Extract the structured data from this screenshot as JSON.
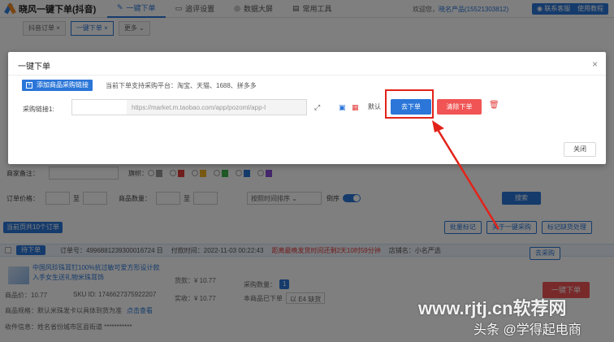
{
  "app": {
    "title": "晓风一键下单(抖音)",
    "nav_tabs": [
      {
        "label": "一键下单",
        "icon": "✎"
      },
      {
        "label": "追评设置",
        "icon": "▭"
      },
      {
        "label": "数据大屏",
        "icon": "◎"
      },
      {
        "label": "常用工具",
        "icon": "▤"
      }
    ],
    "welcome_prefix": "欢迎您，",
    "welcome_user": "晓名产品(15521303812)",
    "contact_label": "联系客服",
    "help_label": "使用教程"
  },
  "page_tabs": [
    {
      "label": "抖音订单 ×"
    },
    {
      "label": "一键下单 ×"
    },
    {
      "label": "更多 ⌄"
    }
  ],
  "background": {
    "remark_label": "商家备注：",
    "flag_label": "旗帜：",
    "price_label": "订单价格：",
    "price_to": "至",
    "qty_label": "商品数量：",
    "sort_placeholder": "按照时间排序",
    "reverse_label": "倒序",
    "search_label": "搜索",
    "current_page_label": "当前页共10个订单",
    "batch_remark": "批量标记",
    "batch_purchase": "关于一键采购",
    "batch_stockout": "标记缺货处理",
    "order_btn": "待下单",
    "order_no": "订单号：4996881239300016724 日",
    "pay_time": "付款时间：2022-11-03 00:22:43",
    "warning": "距离最晚发货时间还剩2天10时59分钟",
    "shop_label": "店铺名：",
    "shop_name": "小名严选",
    "product_title": "中国风珍珠耳钉100%抗过敏可爱方形设计款",
    "product_sub": "入手女生送礼物米珠耳饰",
    "price_info": "商品价：10.77",
    "sku_id": "SKU ID: 1746627375922207",
    "goods_price": "货款：¥ 10.77",
    "paid_amount": "实收：¥ 10.77",
    "purchase_label": "采购数量：",
    "purchase_qty": "1",
    "purchase_status": "本商品已下单",
    "stock_label": "以 E4 缺货",
    "order_now": "一键下单",
    "receiver": "收件信息：姓名省份城市区县街道 ***********",
    "specs": "商品规格：默认米珠发卡以具体到货为准",
    "extra_btn": "去采购",
    "note_btn": "点击查看"
  },
  "modal": {
    "title": "一键下单",
    "add_button_label": "添加商品采购链接",
    "support_text": "当前下单支持采购平台：淘宝、天猫、1688、拼多多",
    "url_label": "采购链接1:",
    "url_placeholder": "https://market.m.taobao.com/app/pozoml/app-l",
    "default_label": "默认",
    "go_order_label": "去下单",
    "clear_label": "清除下单",
    "close_label": "关闭"
  },
  "watermark": {
    "site": "www.rjtj.cn软荐网",
    "author": "头条 @学得起电商"
  },
  "colors": {
    "primary": "#2b76d8",
    "danger": "#f05454",
    "highlight": "#e2231a"
  }
}
